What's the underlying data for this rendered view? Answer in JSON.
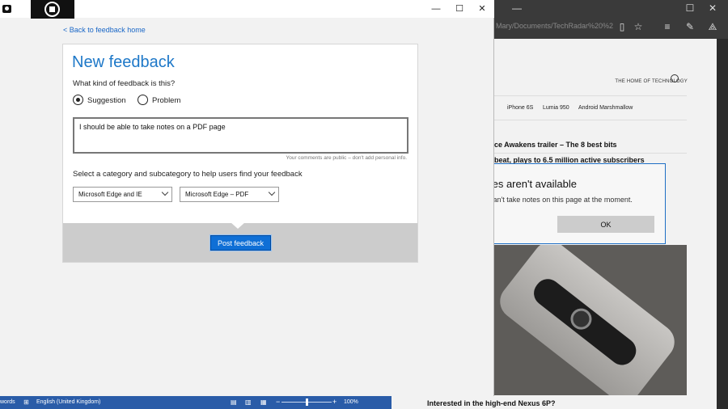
{
  "edge": {
    "url": "Mary/Documents/TechRadar%20%2",
    "window_controls": {
      "minimize": "—",
      "maximize": "☐",
      "close": "✕"
    },
    "toolbar_icons": [
      "reading-view-icon",
      "favorite-star-icon",
      "hub-icon",
      "web-note-icon",
      "share-icon"
    ],
    "site": {
      "tagline": "THE HOME OF TECHNOLOGY",
      "nav": [
        "iPhone 6S",
        "Lumia 950",
        "Android Marshmallow"
      ],
      "headline_1": "ce Awakens trailer – The 8 best bits",
      "headline_2": "beat, plays to 6.5 million active subscribers",
      "photo_caption": "Interested in the high-end Nexus 6P?"
    }
  },
  "notes_dialog": {
    "title": "tes aren't available",
    "message": "can't take notes on this page at the moment.",
    "ok_label": "OK"
  },
  "word_status": {
    "words": "words",
    "language": "English (United Kingdom)",
    "zoom": "100%",
    "zoom_minus": "−",
    "zoom_plus": "+",
    "zoom_level": 0.5
  },
  "feedback_app": {
    "window_controls": {
      "minimize": "—",
      "maximize": "☐",
      "close": "✕"
    },
    "back_link": "< Back to feedback home",
    "heading": "New feedback",
    "kind_question": "What kind of feedback is this?",
    "kind_options": [
      "Suggestion",
      "Problem"
    ],
    "kind_selected": "Suggestion",
    "comment": "I should be able to take notes on a PDF page",
    "privacy_note": "Your comments are public – don't add personal info.",
    "category_prompt": "Select a category and subcategory to help users find your feedback",
    "category": "Microsoft Edge and IE",
    "subcategory": "Microsoft Edge – PDF",
    "post_label": "Post feedback"
  },
  "colors": {
    "accent_blue": "#1e78c8",
    "button_blue": "#0f6fd6",
    "word_blue": "#2a5ca8"
  }
}
